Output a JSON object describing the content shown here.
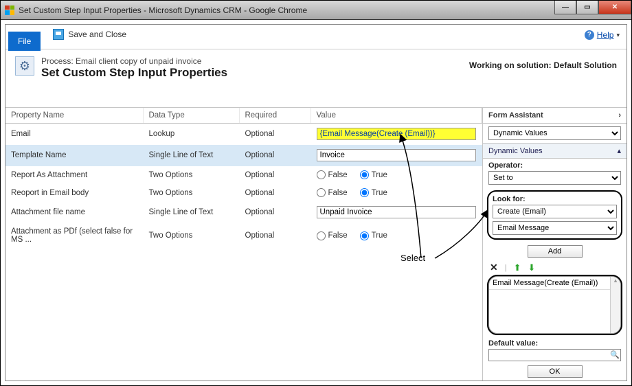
{
  "window": {
    "title": "Set Custom Step Input Properties - Microsoft Dynamics CRM - Google Chrome"
  },
  "toolbar": {
    "file_label": "File",
    "save_close_label": "Save and Close",
    "help_label": "Help"
  },
  "header": {
    "process_line": "Process: Email client copy of unpaid invoice",
    "title": "Set Custom Step Input Properties",
    "solution_label": "Working on solution: Default Solution"
  },
  "columns": {
    "name": "Property Name",
    "type": "Data Type",
    "required": "Required",
    "value": "Value"
  },
  "rows": [
    {
      "name": "Email",
      "type": "Lookup",
      "required": "Optional",
      "valueText": "{Email Message(Create (Email))}",
      "kind": "hi-input",
      "selected": false
    },
    {
      "name": "Template Name",
      "type": "Single Line of Text",
      "required": "Optional",
      "valueText": "Invoice",
      "kind": "input",
      "selected": true
    },
    {
      "name": "Report As Attachment",
      "type": "Two Options",
      "required": "Optional",
      "radio": "True",
      "kind": "radio",
      "selected": false
    },
    {
      "name": "Reoport in Email body",
      "type": "Two Options",
      "required": "Optional",
      "radio": "True",
      "kind": "radio",
      "selected": false
    },
    {
      "name": "Attachment file name",
      "type": "Single Line of Text",
      "required": "Optional",
      "valueText": "Unpaid Invoice",
      "kind": "input",
      "selected": false
    },
    {
      "name": "Attachment as PDf (select false for MS ...",
      "type": "Two Options",
      "required": "Optional",
      "radio": "True",
      "kind": "radio",
      "selected": false
    }
  ],
  "radio_labels": {
    "false": "False",
    "true": "True"
  },
  "form_assistant": {
    "header": "Form Assistant",
    "top_select": "Dynamic Values",
    "section_label": "Dynamic Values",
    "operator_label": "Operator:",
    "operator_value": "Set to",
    "lookfor_label": "Look for:",
    "lookfor_entity": "Create (Email)",
    "lookfor_attr": "Email Message",
    "add_label": "Add",
    "list_item": "Email Message(Create (Email))",
    "default_label": "Default value:",
    "default_value": "",
    "ok_label": "OK"
  },
  "annotation": {
    "select_label": "Select"
  }
}
